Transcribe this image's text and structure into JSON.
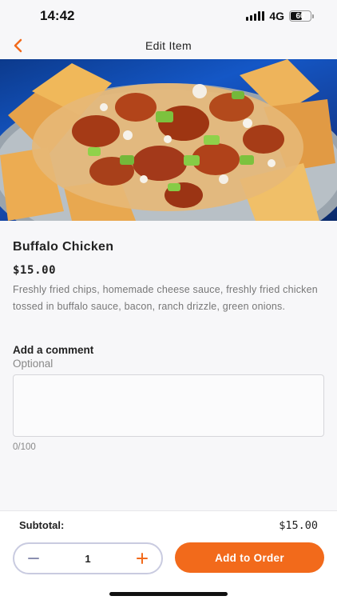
{
  "status_bar": {
    "time": "14:42",
    "network": "4G",
    "battery": "60",
    "battery_level": 0.6
  },
  "nav": {
    "title": "Edit Item",
    "back_icon": "chevron-left-icon",
    "accent_color": "#f26a1b"
  },
  "item": {
    "name": "Buffalo Chicken",
    "price": "$15.00",
    "description": "Freshly fried chips, homemade cheese sauce, freshly fried chicken tossed in buffalo sauce, bacon, ranch drizzle, green onions."
  },
  "comment": {
    "label": "Add a comment",
    "optional": "Optional",
    "value": "",
    "counter": "0/100"
  },
  "footer": {
    "subtotal_label": "Subtotal:",
    "subtotal_value": "$15.00",
    "quantity": "1",
    "add_button": "Add to Order",
    "minus_icon": "minus-icon",
    "plus_icon": "plus-icon"
  }
}
